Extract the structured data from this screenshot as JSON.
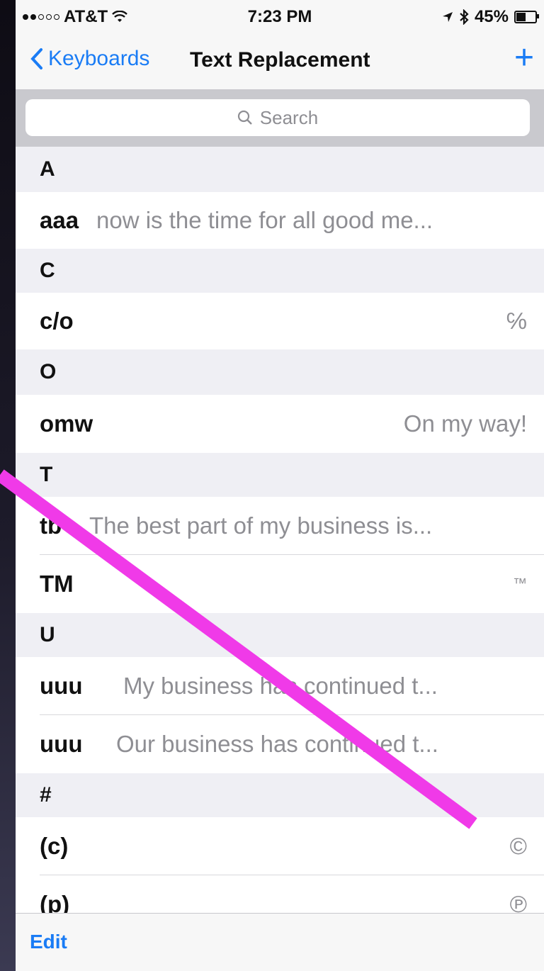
{
  "status_bar": {
    "carrier": "AT&T",
    "time": "7:23 PM",
    "battery": "45%"
  },
  "nav": {
    "back_label": "Keyboards",
    "title": "Text Replacement",
    "add_label": "+"
  },
  "search": {
    "placeholder": "Search"
  },
  "sections": [
    {
      "letter": "A",
      "rows": [
        {
          "shortcut": "aaa",
          "phrase": "now is the time for all good me..."
        }
      ]
    },
    {
      "letter": "C",
      "rows": [
        {
          "shortcut": "c/o",
          "phrase": "℅"
        }
      ]
    },
    {
      "letter": "O",
      "rows": [
        {
          "shortcut": "omw",
          "phrase": "On my way!"
        }
      ]
    },
    {
      "letter": "T",
      "rows": [
        {
          "shortcut": "tb",
          "phrase": "The best part of my business is..."
        },
        {
          "shortcut": "TM",
          "phrase": "™"
        }
      ]
    },
    {
      "letter": "U",
      "rows": [
        {
          "shortcut": "uuu",
          "phrase": "My business has continued t..."
        },
        {
          "shortcut": "uuu",
          "phrase": "Our business has continued t..."
        }
      ]
    },
    {
      "letter": "#",
      "rows": [
        {
          "shortcut": "(c)",
          "phrase": "©"
        },
        {
          "shortcut": "(p)",
          "phrase": "℗"
        }
      ]
    }
  ],
  "toolbar": {
    "edit_label": "Edit"
  },
  "colors": {
    "accent": "#1a7cf5",
    "annotation": "#f03ae8"
  }
}
